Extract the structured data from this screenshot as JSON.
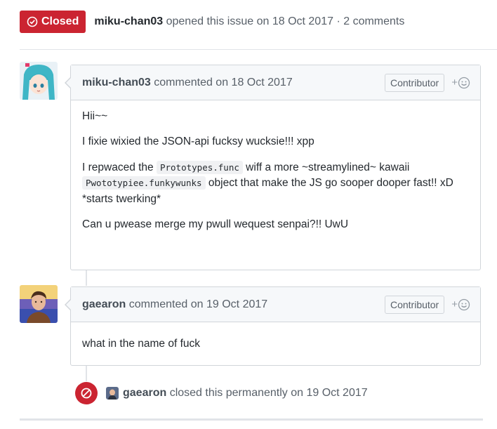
{
  "header": {
    "state_label": "Closed",
    "author": "miku-chan03",
    "opened_text": "opened this issue on 18 Oct 2017 · 2 comments"
  },
  "comments": [
    {
      "author": "miku-chan03",
      "meta": "commented on 18 Oct 2017",
      "role": "Contributor",
      "reaction_label": "+",
      "avatar_icon": "anime-avatar",
      "body": {
        "p1": "Hii~~",
        "p2": "I fixie wixied the JSON-api fucksy wucksie!!! xpp",
        "p3_before": "I repwaced the ",
        "p3_code1": "Prototypes.func",
        "p3_mid": " wiff a more ~streamylined~ kawaii ",
        "p3_code2": "Pwototypiee.funkywunks",
        "p3_after": " object that make the JS go sooper dooper fast!! xD *starts twerking*",
        "p4": "Can u pwease merge my pwull wequest senpai?!! UwU"
      }
    },
    {
      "author": "gaearon",
      "meta": "commented on 19 Oct 2017",
      "role": "Contributor",
      "reaction_label": "+",
      "avatar_icon": "person-avatar",
      "body": {
        "p1": "what in the name of fuck"
      }
    }
  ],
  "event": {
    "icon": "circle-slash-icon",
    "actor": "gaearon",
    "text": "closed this permanently on 19 Oct 2017"
  },
  "colors": {
    "closed_red": "#cb2431",
    "border": "#d1d5da",
    "header_bg": "#f6f8fa"
  }
}
